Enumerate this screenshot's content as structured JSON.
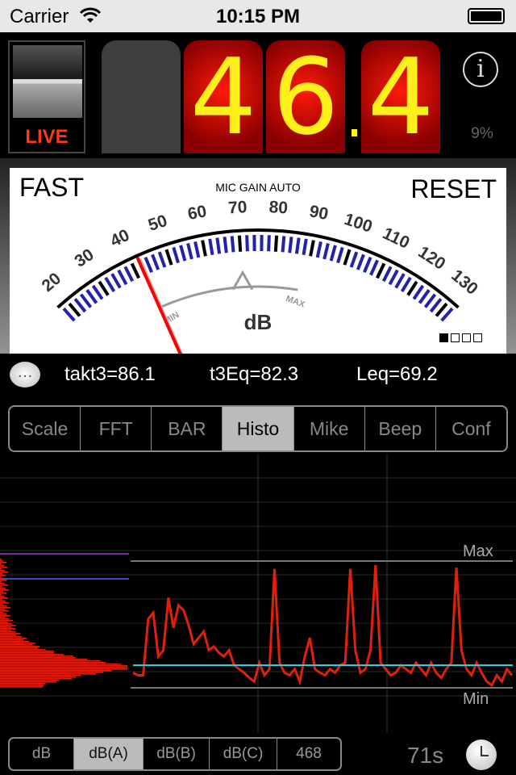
{
  "status_bar": {
    "carrier": "Carrier",
    "time": "10:15 PM",
    "icons": [
      "wifi-icon",
      "battery-icon"
    ]
  },
  "display": {
    "live_label": "LIVE",
    "digits": [
      "",
      "4",
      "6",
      "4"
    ],
    "decimal": ".",
    "battery_percent": "9%",
    "info_icon": "info-icon"
  },
  "meter": {
    "response_mode": "FAST",
    "mic_gain": "MIC GAIN AUTO",
    "reset_label": "RESET",
    "unit": "dB",
    "scale_labels": [
      "20",
      "30",
      "40",
      "50",
      "60",
      "70",
      "80",
      "90",
      "100",
      "110",
      "120",
      "130"
    ],
    "min_label": "MIN",
    "max_label": "MAX",
    "needle_value": 42,
    "peak_marker_value": 70,
    "page_count": 4,
    "current_page": 1
  },
  "stats": {
    "takt3": "takt3=86.1",
    "t3eq": "t3Eq=82.3",
    "leq": "Leq=69.2",
    "chat_icon": "speech-bubble-icon"
  },
  "tabs": [
    {
      "label": "Scale"
    },
    {
      "label": "FFT"
    },
    {
      "label": "BAR"
    },
    {
      "label": "Histo",
      "selected": true
    },
    {
      "label": "Mike"
    },
    {
      "label": "Beep"
    },
    {
      "label": "Conf"
    }
  ],
  "chart_data": {
    "type": "line",
    "max_label": "Max",
    "min_label": "Min",
    "trace_color": "#e0200a",
    "leq_line_color": "#2ad0e0",
    "trace": [
      0.12,
      0.1,
      0.1,
      0.55,
      0.6,
      0.25,
      0.3,
      0.72,
      0.48,
      0.66,
      0.62,
      0.5,
      0.35,
      0.4,
      0.45,
      0.3,
      0.33,
      0.28,
      0.25,
      0.3,
      0.18,
      0.15,
      0.12,
      0.08,
      0.05,
      0.2,
      0.1,
      0.15,
      0.95,
      0.2,
      0.12,
      0.1,
      0.15,
      0.05,
      0.25,
      0.4,
      0.15,
      0.12,
      0.1,
      0.15,
      0.12,
      0.18,
      0.2,
      0.95,
      0.3,
      0.12,
      0.15,
      0.3,
      0.98,
      0.2,
      0.15,
      0.1,
      0.12,
      0.18,
      0.15,
      0.12,
      0.2,
      0.15,
      0.1,
      0.2,
      0.12,
      0.08,
      0.15,
      0.2,
      0.96,
      0.3,
      0.15,
      0.1,
      0.2,
      0.12,
      0.05,
      0.02,
      0.1,
      0.05,
      0.15,
      0.1
    ]
  },
  "bottom": {
    "weightings": [
      {
        "label": "dB"
      },
      {
        "label": "dB(A)",
        "selected": true
      },
      {
        "label": "dB(B)"
      },
      {
        "label": "dB(C)"
      },
      {
        "label": "468"
      }
    ],
    "duration": "71s",
    "clock_icon": "clock-icon"
  }
}
